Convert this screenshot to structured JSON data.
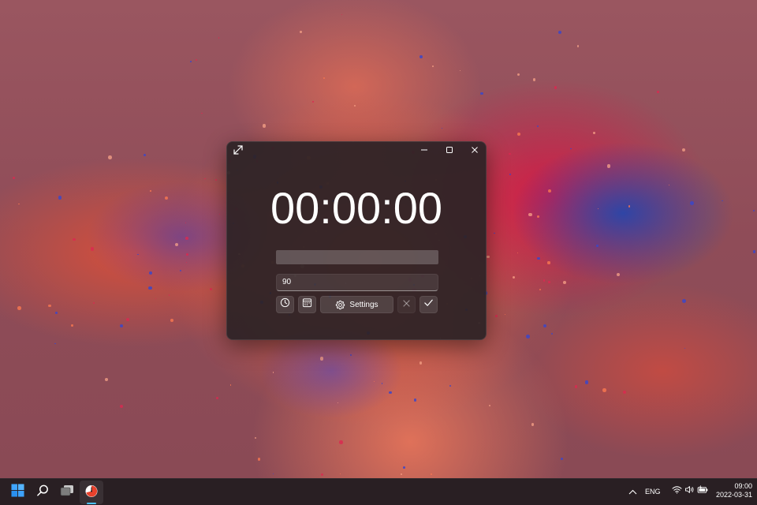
{
  "window": {
    "timer_display": "00:00:00",
    "progress_fraction": 0,
    "minutes_input_value": "90",
    "settings_label": "Settings",
    "accent_color": "#4cc2ff",
    "icons": {
      "expand": "expand-arrows-icon",
      "minimize": "minimize-icon",
      "maximize": "maximize-icon",
      "close": "close-icon",
      "clock": "clock-icon",
      "calendar": "calendar-icon",
      "settings": "gear-icon",
      "cancel": "x-icon",
      "confirm": "checkmark-icon"
    }
  },
  "taskbar": {
    "items": [
      "start-icon",
      "search-icon",
      "task-view-icon",
      "timer-app-icon"
    ],
    "tray": {
      "language": "ENG",
      "time": "09:00",
      "date": "2022-03-31"
    }
  }
}
